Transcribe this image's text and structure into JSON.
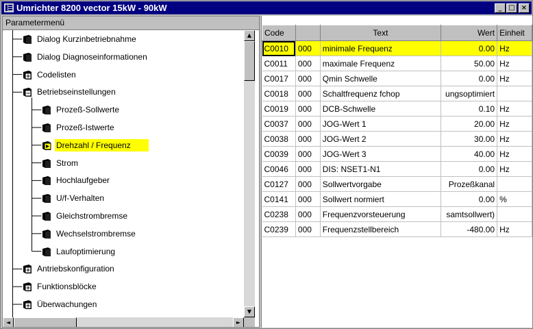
{
  "window": {
    "title": "Umrichter 8200 vector 15kW - 90kW",
    "buttons": {
      "minimize": "_",
      "maximize": "□",
      "close": "×"
    }
  },
  "tree": {
    "header": "Parametermenü",
    "nodes": [
      {
        "label": "Dialog Kurzinbetriebnahme",
        "level": 0,
        "icon": "leaf-book-icon"
      },
      {
        "label": "Dialog Diagnoseinformationen",
        "level": 0,
        "icon": "leaf-book-icon"
      },
      {
        "label": "Codelisten",
        "level": 0,
        "icon": "expand-plus-icon"
      },
      {
        "label": "Betriebseinstellungen",
        "level": 0,
        "icon": "collapse-minus-icon"
      },
      {
        "label": "Prozeß-Sollwerte",
        "level": 1,
        "icon": "leaf-book-icon"
      },
      {
        "label": "Prozeß-Istwerte",
        "level": 1,
        "icon": "leaf-book-icon"
      },
      {
        "label": "Drehzahl / Frequenz",
        "level": 1,
        "icon": "selected-arrow-icon",
        "selected": true
      },
      {
        "label": "Strom",
        "level": 1,
        "icon": "leaf-book-icon"
      },
      {
        "label": "Hochlaufgeber",
        "level": 1,
        "icon": "leaf-book-icon"
      },
      {
        "label": "U/f-Verhalten",
        "level": 1,
        "icon": "leaf-book-icon"
      },
      {
        "label": "Gleichstrombremse",
        "level": 1,
        "icon": "leaf-book-icon"
      },
      {
        "label": "Wechselstrombremse",
        "level": 1,
        "icon": "leaf-book-icon"
      },
      {
        "label": "Laufoptimierung",
        "level": 1,
        "icon": "leaf-book-icon"
      },
      {
        "label": "Antriebskonfiguration",
        "level": 0,
        "icon": "expand-plus-icon"
      },
      {
        "label": "Funktionsblöcke",
        "level": 0,
        "icon": "expand-plus-icon"
      },
      {
        "label": "Überwachungen",
        "level": 0,
        "icon": "expand-plus-icon"
      }
    ]
  },
  "table": {
    "headers": {
      "code": "Code",
      "sub": "",
      "text": "Text",
      "wert": "Wert",
      "einheit": "Einheit"
    },
    "rows": [
      {
        "code": "C0010",
        "sub": "000",
        "text": "minimale Frequenz",
        "wert": "0.00",
        "einheit": "Hz",
        "highlight": true
      },
      {
        "code": "C0011",
        "sub": "000",
        "text": "maximale Frequenz",
        "wert": "50.00",
        "einheit": "Hz"
      },
      {
        "code": "C0017",
        "sub": "000",
        "text": "Qmin Schwelle",
        "wert": "0.00",
        "einheit": "Hz"
      },
      {
        "code": "C0018",
        "sub": "000",
        "text": "Schaltfrequenz fchop",
        "wert": "ungsoptimiert",
        "einheit": ""
      },
      {
        "code": "C0019",
        "sub": "000",
        "text": "DCB-Schwelle",
        "wert": "0.10",
        "einheit": "Hz"
      },
      {
        "code": "C0037",
        "sub": "000",
        "text": "JOG-Wert 1",
        "wert": "20.00",
        "einheit": "Hz"
      },
      {
        "code": "C0038",
        "sub": "000",
        "text": "JOG-Wert 2",
        "wert": "30.00",
        "einheit": "Hz"
      },
      {
        "code": "C0039",
        "sub": "000",
        "text": "JOG-Wert 3",
        "wert": "40.00",
        "einheit": "Hz"
      },
      {
        "code": "C0046",
        "sub": "000",
        "text": "DIS: NSET1-N1",
        "wert": "0.00",
        "einheit": "Hz"
      },
      {
        "code": "C0127",
        "sub": "000",
        "text": "Sollwertvorgabe",
        "wert": "Prozeßkanal",
        "einheit": ""
      },
      {
        "code": "C0141",
        "sub": "000",
        "text": "Sollwert normiert",
        "wert": "0.00",
        "einheit": "%"
      },
      {
        "code": "C0238",
        "sub": "000",
        "text": "Frequenzvorsteuerung",
        "wert": "samtsollwert)",
        "einheit": ""
      },
      {
        "code": "C0239",
        "sub": "000",
        "text": "Frequenzstellbereich",
        "wert": "-480.00",
        "einheit": "Hz"
      }
    ]
  },
  "scroll": {
    "up": "▲",
    "down": "▼",
    "left": "◄",
    "right": "►"
  }
}
